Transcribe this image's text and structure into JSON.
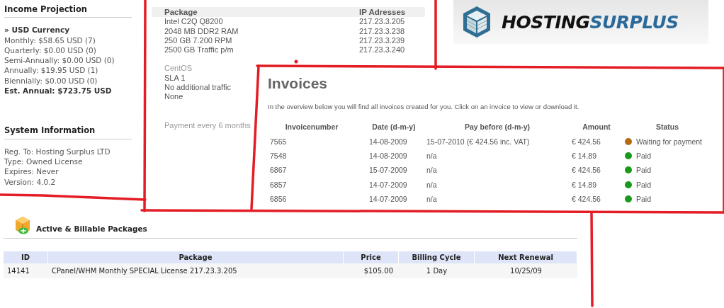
{
  "income_projection": {
    "title": "Income Projection",
    "currency": "» USD Currency",
    "lines": [
      "Monthly: $58.65 USD (7)",
      "Quarterly: $0.00 USD (0)",
      "Semi-Annually: $0.00 USD (0)",
      "Annually: $19.95 USD (1)",
      "Biennially: $0.00 USD (0)"
    ],
    "estimate": "Est. Annual: $723.75 USD"
  },
  "system_information": {
    "title": "System Information",
    "lines": [
      "Reg. To: Hosting Surplus LTD",
      "Type: Owned License",
      "Expires: Never",
      "Version: 4.0.2"
    ]
  },
  "server": {
    "columns": [
      "Package",
      "IP Adresses"
    ],
    "specs": [
      "Intel C2Q Q8200",
      "2048 MB DDR2 RAM",
      "250 GB 7.200 RPM",
      "2500 GB Traffic p/m"
    ],
    "ips": [
      "217.23.3.205",
      "217.23.3.238",
      "217.23.3.239",
      "217.23.3.240"
    ],
    "options": [
      "CentOS",
      "SLA 1",
      "No additional traffic",
      "None"
    ],
    "payment": "Payment every 6 months"
  },
  "logo": {
    "words": [
      "HOSTING",
      "SURPLUS"
    ]
  },
  "invoices": {
    "title": "Invoices",
    "intro": "In the overview below you will find all invoices created for you. Click on an invoice to view or download it.",
    "columns": [
      "Invoicenumber",
      "Date (d-m-y)",
      "Pay before (d-m-y)",
      "Amount",
      "Status"
    ],
    "rows": [
      {
        "number": "7565",
        "date": "14-08-2009",
        "pay_before": "15-07-2010 (€ 424.56 inc. VAT)",
        "amount": "€ 424.56",
        "status": "Waiting for payment",
        "color": "#b86a10"
      },
      {
        "number": "7548",
        "date": "14-08-2009",
        "pay_before": "n/a",
        "amount": "€ 14.89",
        "status": "Paid",
        "color": "#1a9a1a"
      },
      {
        "number": "6867",
        "date": "15-07-2009",
        "pay_before": "n/a",
        "amount": "€ 424.56",
        "status": "Paid",
        "color": "#1a9a1a"
      },
      {
        "number": "6857",
        "date": "14-07-2009",
        "pay_before": "n/a",
        "amount": "€ 14.89",
        "status": "Paid",
        "color": "#1a9a1a"
      },
      {
        "number": "6856",
        "date": "14-07-2009",
        "pay_before": "n/a",
        "amount": "€ 424.56",
        "status": "Paid",
        "color": "#1a9a1a"
      }
    ]
  },
  "packages": {
    "title": "Active & Billable Packages",
    "columns": [
      "ID",
      "Package",
      "Price",
      "Billing Cycle",
      "Next Renewal"
    ],
    "rows": [
      {
        "id": "14141",
        "package": "CPanel/WHM Monthly SPECIAL License 217.23.3.205",
        "price": "$105.00",
        "billing_cycle": "1 Day",
        "next_renewal": "10/25/09"
      }
    ]
  }
}
